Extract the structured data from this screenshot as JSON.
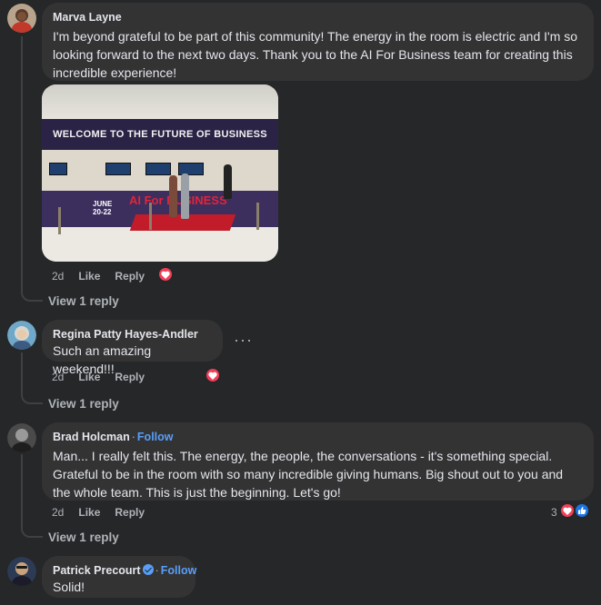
{
  "comments": [
    {
      "author": "Marva Layne",
      "text": "I'm beyond grateful to be part of this community! The energy in the room is electric and I'm so looking forward to the next two days. Thank you to the AI For Business team for creating this incredible experience!",
      "photo": {
        "banner": "WELCOME TO THE FUTURE OF BUSINESS",
        "desk_date": "JUNE 20-22",
        "desk_brand": "AI For BUSINESS"
      },
      "time": "2d",
      "like": "Like",
      "reply": "Reply",
      "reactions": [
        "heart-icon"
      ],
      "view_replies": "View 1 reply"
    },
    {
      "author": "Regina Patty Hayes-Andler",
      "text": "Such an amazing weekend!!!",
      "time": "2d",
      "like": "Like",
      "reply": "Reply",
      "reactions": [
        "heart-icon"
      ],
      "more": "···",
      "view_replies": "View 1 reply"
    },
    {
      "author": "Brad Holcman",
      "separator": "·",
      "follow": "Follow",
      "text": "Man... I really felt this. The energy, the people, the conversations - it's something special. Grateful to be in the room with so many incredible giving humans. Big shout out to you and the whole team. This is just the beginning. Let's go!",
      "time": "2d",
      "like": "Like",
      "reply": "Reply",
      "reactions": [
        "heart-icon",
        "thumbs-up-icon"
      ],
      "reaction_count": "3",
      "view_replies": "View 1 reply"
    },
    {
      "author": "Patrick Precourt",
      "separator": "·",
      "follow": "Follow",
      "text": "Solid!"
    }
  ],
  "colors": {
    "background": "#252728",
    "bubble": "#333334",
    "follow": "#599ef8",
    "heart": "#f33e58",
    "like": "#1b74e4"
  }
}
